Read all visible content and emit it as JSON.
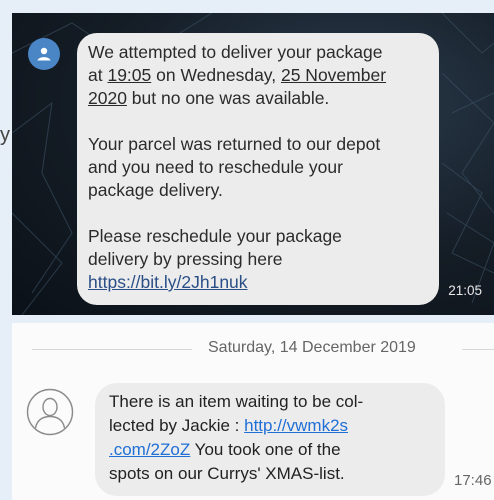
{
  "edge_fragment": "y",
  "thread_top": {
    "message": {
      "p1_a": "We attempted to deliver your package",
      "p1_b_time": "19:05",
      "p1_b_rest": " on Wednesday, ",
      "p1_b_date": "25 November",
      "p1_c_date": "2020",
      "p1_c_rest": " but no one was available.",
      "p2_a": "Your parcel was returned to our depot",
      "p2_b": "and you need to reschedule your",
      "p2_c": "package delivery.",
      "p3_a": "Please reschedule your package",
      "p3_b": "delivery by pressing here",
      "link": "https://bit.ly/2Jh1nuk"
    },
    "timestamp": "21:05",
    "avatar_icon": "person-icon"
  },
  "thread_bottom": {
    "date_separator": "Saturday, 14 December 2019",
    "message": {
      "l1": "There is an item waiting to be col-",
      "l2_text": "lected by Jackie : ",
      "l2_link": "http://vwmk2s",
      "l3_link": ".com/2ZoZ",
      "l3_text": " You took one of the",
      "l4": "spots on our Currys' XMAS-list."
    },
    "timestamp": "17:46",
    "avatar_icon": "person-outline-icon"
  },
  "colors": {
    "page_bg": "#e6eef7",
    "dark_bg": "#141c25",
    "bubble_bg": "#ececec",
    "avatar_blue": "#4a86c5",
    "link_dark": "#2a4f86",
    "link_light": "#1f6fd6"
  }
}
